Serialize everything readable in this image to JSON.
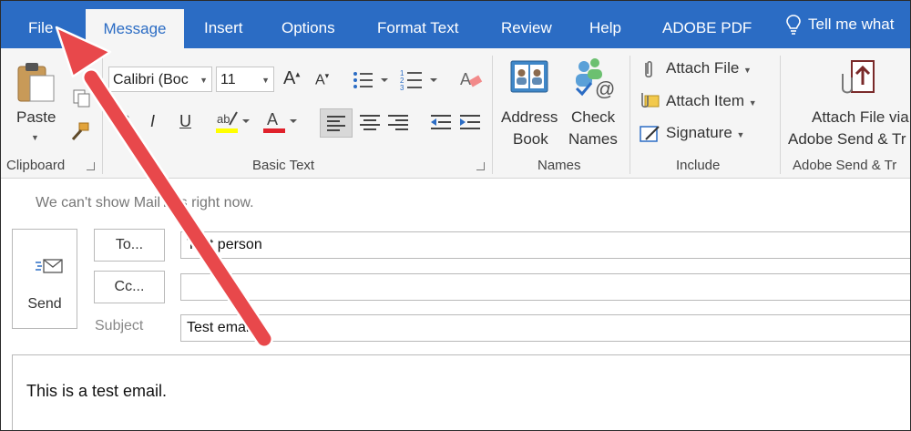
{
  "tabs": [
    "File",
    "Message",
    "Insert",
    "Options",
    "Format Text",
    "Review",
    "Help",
    "ADOBE PDF"
  ],
  "tell_me": "Tell me what",
  "clipboard": {
    "paste": "Paste",
    "label": "Clipboard"
  },
  "basic_text": {
    "font": "Calibri (Boc",
    "size": "11",
    "label": "Basic Text",
    "bold": "B",
    "italic": "I",
    "underline": "U"
  },
  "names": {
    "address_book_line1": "Address",
    "address_book_line2": "Book",
    "check_names_line1": "Check",
    "check_names_line2": "Names",
    "label": "Names"
  },
  "include": {
    "attach_file": "Attach File",
    "attach_item": "Attach Item",
    "signature": "Signature",
    "label": "Include"
  },
  "adobe": {
    "attach_line1": "Attach File via",
    "attach_line2": "Adobe Send & Tr",
    "label": "Adobe Send & Tr"
  },
  "infobar": "We can't show MailTips right now.",
  "send_label": "Send",
  "to_button": "To...",
  "cc_button": "Cc...",
  "to_value": "Test person",
  "cc_value": "",
  "subject_label": "Subject",
  "subject_value": "Test email",
  "body_text": "This is a test email.",
  "colors": {
    "ribbon_blue": "#2b6cc4",
    "arrow": "#e8484b",
    "highlight": "#ffff00",
    "font_red": "#e0212b"
  }
}
